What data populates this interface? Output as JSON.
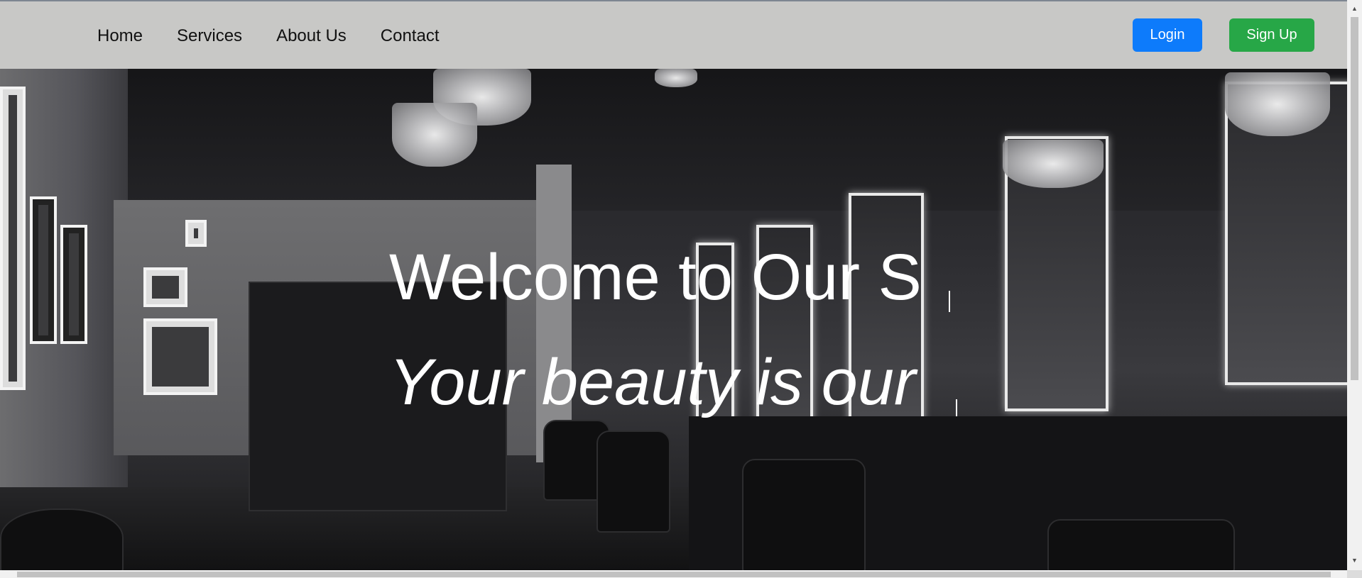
{
  "navbar": {
    "links": [
      {
        "label": "Home"
      },
      {
        "label": "Services"
      },
      {
        "label": "About Us"
      },
      {
        "label": "Contact"
      }
    ],
    "login_label": "Login",
    "signup_label": "Sign Up",
    "login_color": "#0d7bfb",
    "signup_color": "#27a747",
    "background": "#c8c8c6"
  },
  "hero": {
    "title": "Welcome to Our S",
    "subtitle": "Your beauty is our",
    "background_image": "salon-interior-photo",
    "text_color": "#ffffff"
  },
  "scrollbars": {
    "up_icon": "scroll-up-arrow-icon",
    "down_icon": "scroll-down-arrow-icon"
  }
}
